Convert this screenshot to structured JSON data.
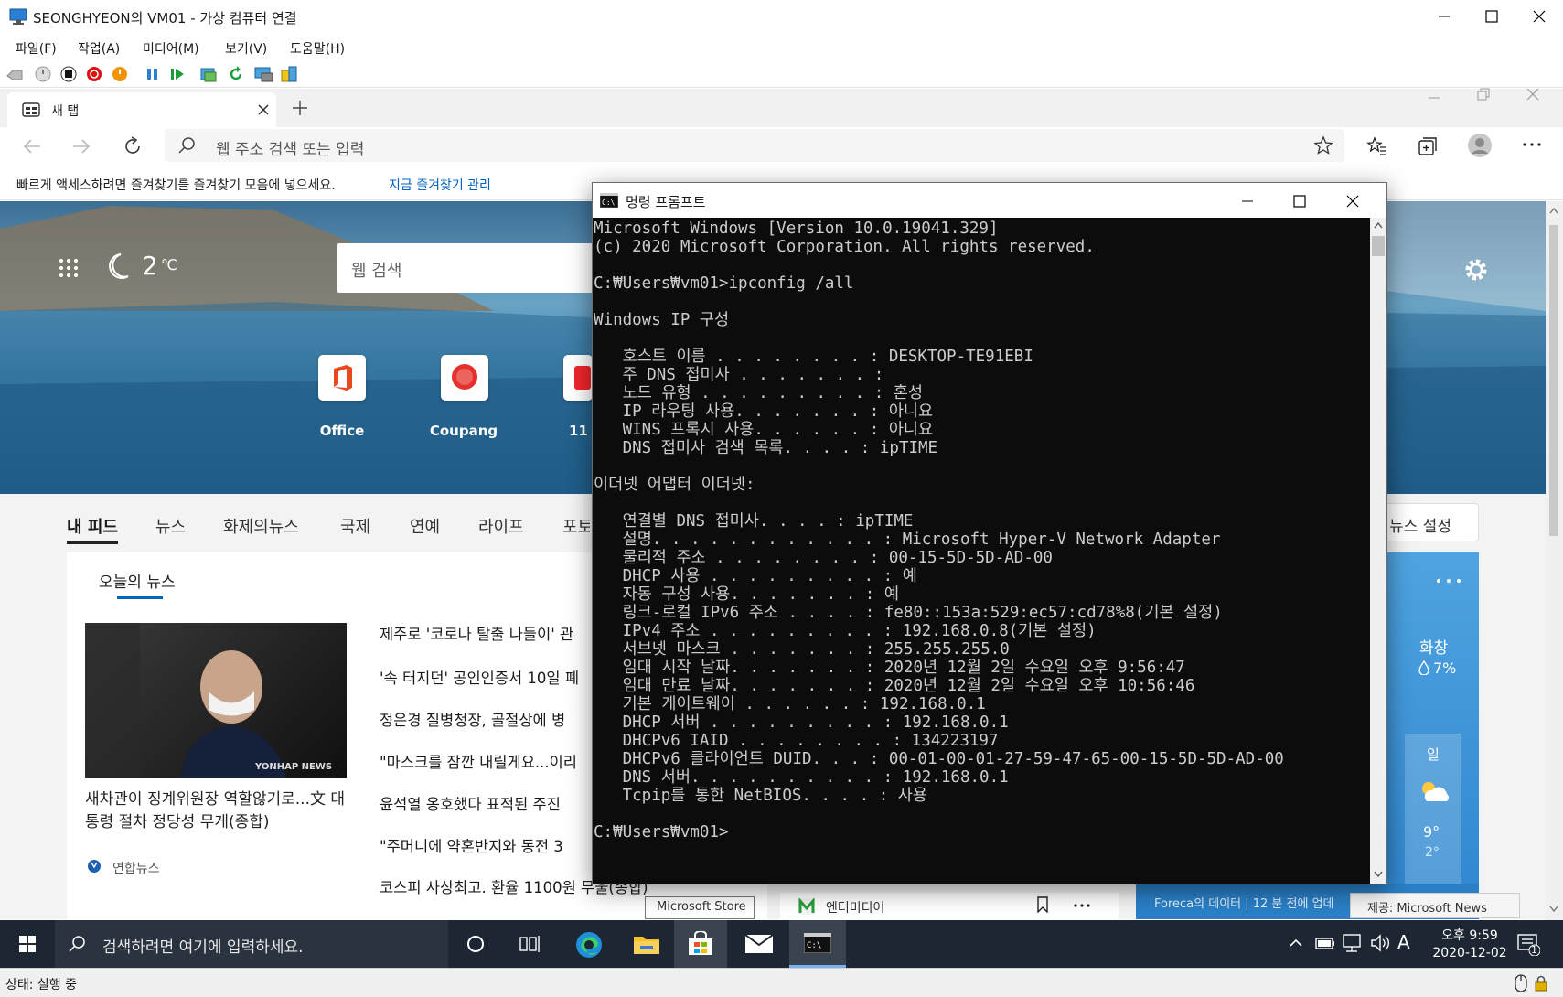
{
  "vm": {
    "title": "SEONGHYEON의 VM01 - 가상 컴퓨터 연결",
    "menu": [
      "파일(F)",
      "작업(A)",
      "미디어(M)",
      "보기(V)",
      "도움말(H)"
    ],
    "status": "상태: 실행 중"
  },
  "edge": {
    "tab_title": "새 탭",
    "address_placeholder": "웹 주소 검색 또는 입력",
    "favbar_text": "빠르게 액세스하려면 즐겨찾기를 즐겨찾기 모음에 넣으세요.",
    "favbar_link": "지금 즐겨찾기 관리"
  },
  "ntp": {
    "weather_temp": "2",
    "weather_unit": "℃",
    "search_placeholder": "웹 검색",
    "quicklinks": [
      "Office",
      "Coupang",
      "11"
    ],
    "feed_tabs": [
      "내 피드",
      "뉴스",
      "화제의뉴스",
      "국제",
      "연예",
      "라이프",
      "포토"
    ],
    "personalize": "뉴스 설정",
    "today_news": "오늘의 뉴스",
    "hero_headline": "새차관이 징계위원장 역할않기로...文 대통령 절차 정당성 무게(종합)",
    "source": "연합뉴스",
    "photo_watermark": "YONHAP NEWS",
    "headlines": [
      "제주로 '코로나 탈출 나들이' 관",
      "'속 터지던' 공인인증서 10일 폐",
      "정은경 질병청장, 골절상에 병",
      "\"마스크를 잠깐 내릴게요...이리",
      "윤석열 옹호했다 표적된 주진",
      "\"주머니에 약혼반지와 동전 3",
      "코스피 사상최고. 환율 1100원 무울(종합)"
    ],
    "tooltip": "Microsoft Store",
    "bottom_source": "엔터미디어",
    "weather_card": {
      "day1": "화창",
      "precip": "7%",
      "day2": "일",
      "high": "9°",
      "low": "2°",
      "footer": "Foreca의 데이터 | 12 분 전에 업데",
      "provider": "제공: Microsoft News"
    }
  },
  "cmd": {
    "title": "명령 프롬프트",
    "lines": [
      "Microsoft Windows [Version 10.0.19041.329]",
      "(c) 2020 Microsoft Corporation. All rights reserved.",
      "",
      "C:₩Users₩vm01>ipconfig /all",
      "",
      "Windows IP 구성",
      "",
      "   호스트 이름 . . . . . . . . : DESKTOP-TE91EBI",
      "   주 DNS 접미사 . . . . . . . :",
      "   노드 유형 . . . . . . . . . : 혼성",
      "   IP 라우팅 사용. . . . . . . : 아니요",
      "   WINS 프록시 사용. . . . . . : 아니요",
      "   DNS 접미사 검색 목록. . . . : ipTIME",
      "",
      "이더넷 어댑터 이더넷:",
      "",
      "   연결별 DNS 접미사. . . . : ipTIME",
      "   설명. . . . . . . . . . . . : Microsoft Hyper-V Network Adapter",
      "   물리적 주소 . . . . . . . . : 00-15-5D-5D-AD-00",
      "   DHCP 사용 . . . . . . . . . : 예",
      "   자동 구성 사용. . . . . . . : 예",
      "   링크-로컬 IPv6 주소 . . . . : fe80::153a:529:ec57:cd78%8(기본 설정)",
      "   IPv4 주소 . . . . . . . . . : 192.168.0.8(기본 설정)",
      "   서브넷 마스크 . . . . . . . : 255.255.255.0",
      "   임대 시작 날짜. . . . . . . : 2020년 12월 2일 수요일 오후 9:56:47",
      "   임대 만료 날짜. . . . . . . : 2020년 12월 2일 수요일 오후 10:56:46",
      "   기본 게이트웨이 . . . . . . : 192.168.0.1",
      "   DHCP 서버 . . . . . . . . . : 192.168.0.1",
      "   DHCPv6 IAID . . . . . . . . : 134223197",
      "   DHCPv6 클라이언트 DUID. . . : 00-01-00-01-27-59-47-65-00-15-5D-5D-AD-00",
      "   DNS 서버. . . . . . . . . . : 192.168.0.1",
      "   Tcpip를 통한 NetBIOS. . . . : 사용",
      "",
      "C:₩Users₩vm01>"
    ]
  },
  "taskbar": {
    "search_placeholder": "검색하려면 여기에 입력하세요.",
    "time": "오후 9:59",
    "date": "2020-12-02",
    "ime": "A",
    "notification_count": "1"
  }
}
